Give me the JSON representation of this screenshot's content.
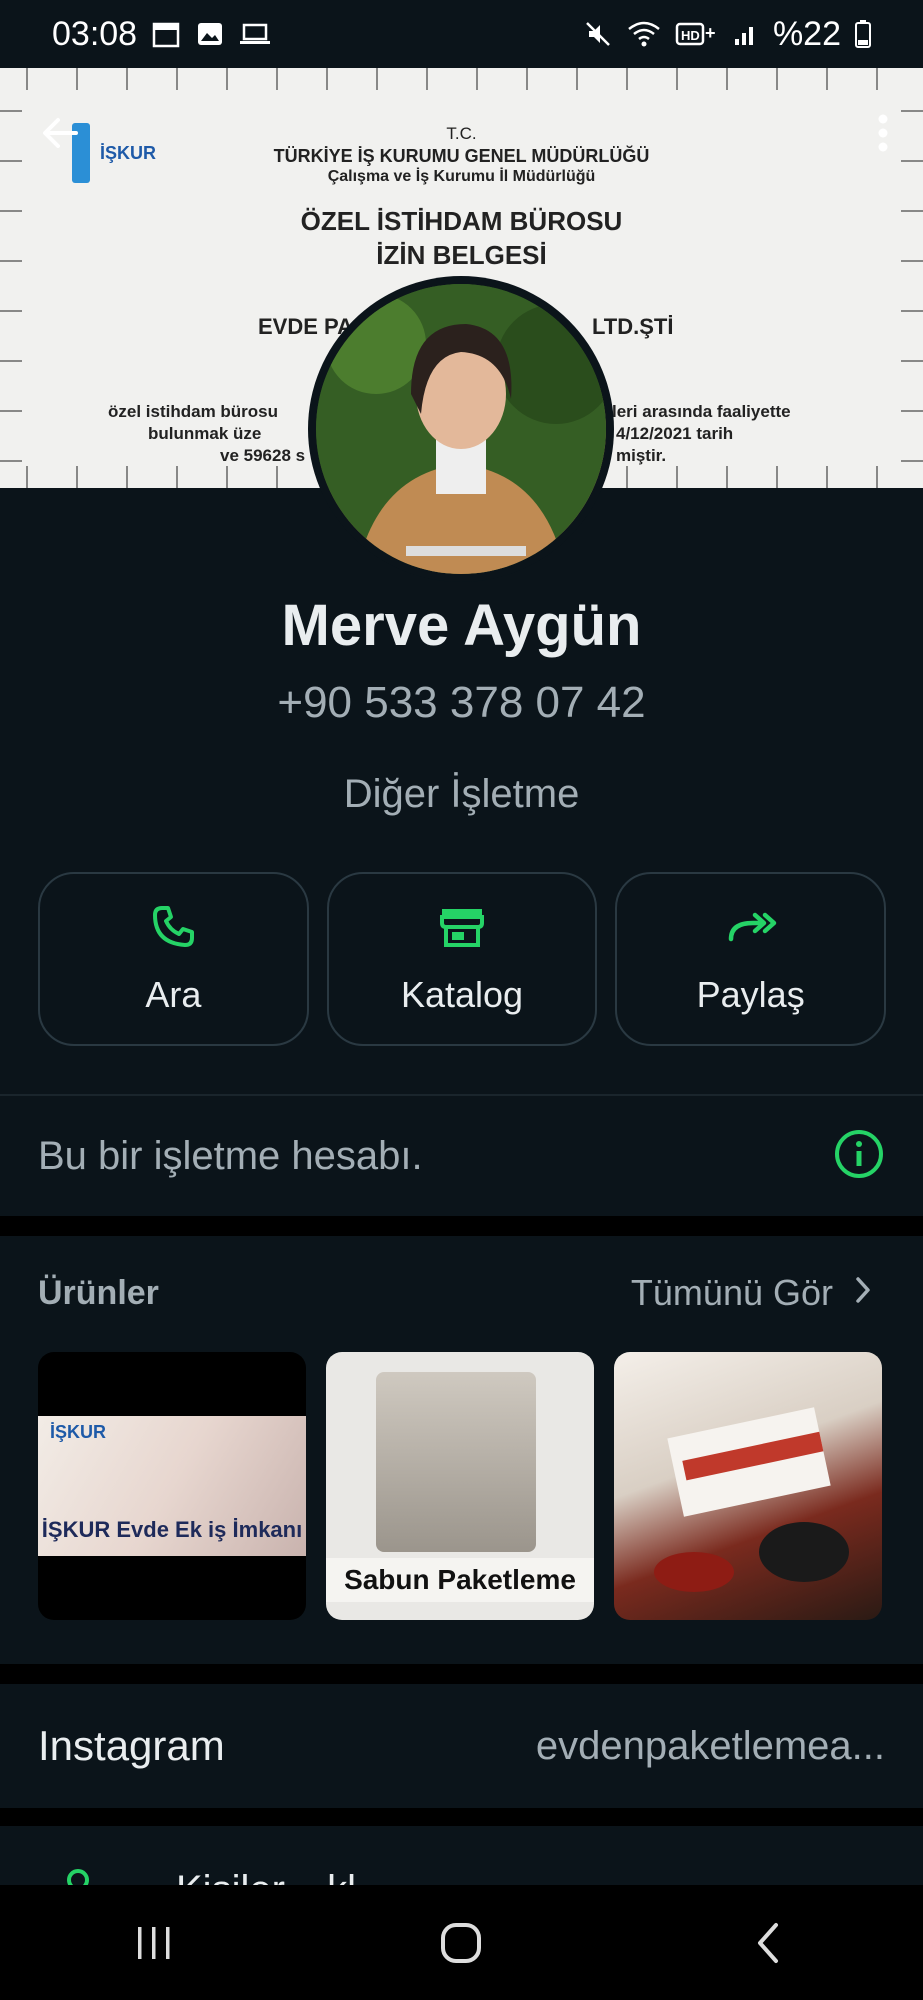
{
  "status_bar": {
    "time": "03:08",
    "battery": "%22",
    "left_icons": [
      "calendar-icon",
      "gallery-icon",
      "laptop-icon"
    ],
    "right_icons": [
      "mute-icon",
      "wifi-icon",
      "hd-icon",
      "signal-icon",
      "battery-icon"
    ]
  },
  "cover": {
    "document_lines": [
      "T.C.",
      "TÜRKİYE İŞ KURUMU GENEL MÜDÜRLÜĞÜ",
      "Çalışma ve İş Kurumu İl Müdürlüğü",
      "ÖZEL İSTİHDAM BÜROSU",
      "İZİN BELGESİ",
      "EVDE PA",
      "LTD.ŞTİ",
      "özel istihdam bürosu",
      "leri arasında faaliyette",
      "bulunmak üze",
      "4/12/2021 tarih",
      "ve 59628 s",
      "miştir."
    ],
    "logo_text": "İŞKUR"
  },
  "profile": {
    "name": "Merve Aygün",
    "phone": "+90 533 378 07 42",
    "category": "Diğer İşletme"
  },
  "actions": [
    {
      "label": "Ara",
      "icon": "phone-icon"
    },
    {
      "label": "Katalog",
      "icon": "store-icon"
    },
    {
      "label": "Paylaş",
      "icon": "forward-icon"
    }
  ],
  "business_notice": "Bu bir işletme hesabı.",
  "products": {
    "title": "Ürünler",
    "see_all": "Tümünü Gör",
    "items": [
      {
        "brand": "İŞKUR",
        "caption": "İŞKUR Evde Ek iş İmkanı"
      },
      {
        "caption": "Sabun Paketleme"
      },
      {
        "caption": ""
      }
    ]
  },
  "instagram": {
    "label": "Instagram",
    "value": "evdenpaketlemea..."
  },
  "partial_row_text": "Kişiler... kl...",
  "accent_color": "#25d366"
}
